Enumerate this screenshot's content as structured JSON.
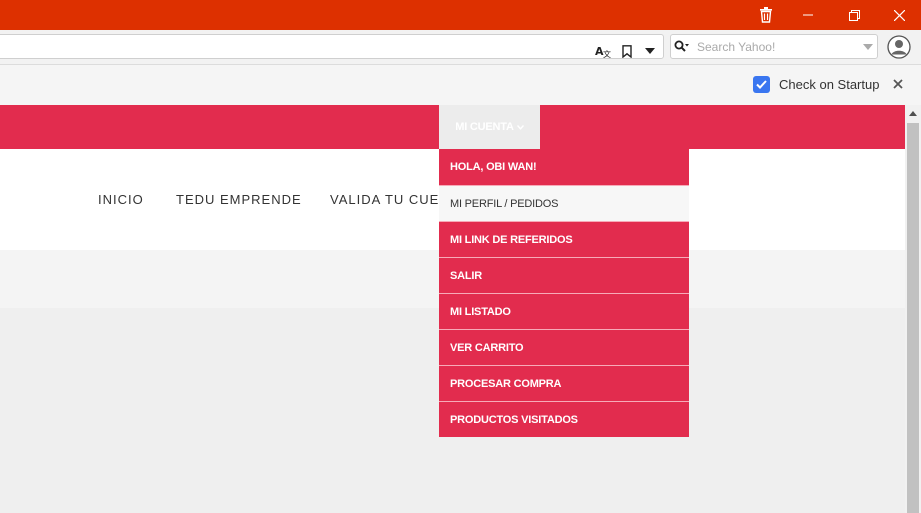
{
  "browser": {
    "window_controls": {
      "trash_icon": "trash-icon",
      "minimize": "–",
      "restore": "❐",
      "close": "✕"
    },
    "address_bar": {
      "value": "",
      "translate_icon": "translate-icon",
      "bookmark_icon": "bookmark-icon",
      "menu_arrow": "▾"
    },
    "search": {
      "placeholder": "Search Yahoo!",
      "value": ""
    },
    "infobar": {
      "checkbox_checked": true,
      "label": "Check on Startup",
      "close": "✕"
    }
  },
  "site": {
    "top_menu": {
      "label": "MI CUENTA",
      "chevron": "⌄"
    },
    "nav": [
      "INICIO",
      "TEDU EMPRENDE",
      "VALIDA TU CUE"
    ],
    "dropdown": [
      "HOLA, OBI WAN!",
      "MI PERFIL / PEDIDOS",
      "MI LINK DE REFERIDOS",
      "SALIR",
      "MI LISTADO",
      "VER CARRITO",
      "PROCESAR COMPRA",
      "PRODUCTOS VISITADOS"
    ]
  },
  "colors": {
    "titlebar": "#dd3000",
    "brand": "#e22c4e",
    "checkbox": "#3a76f0"
  }
}
